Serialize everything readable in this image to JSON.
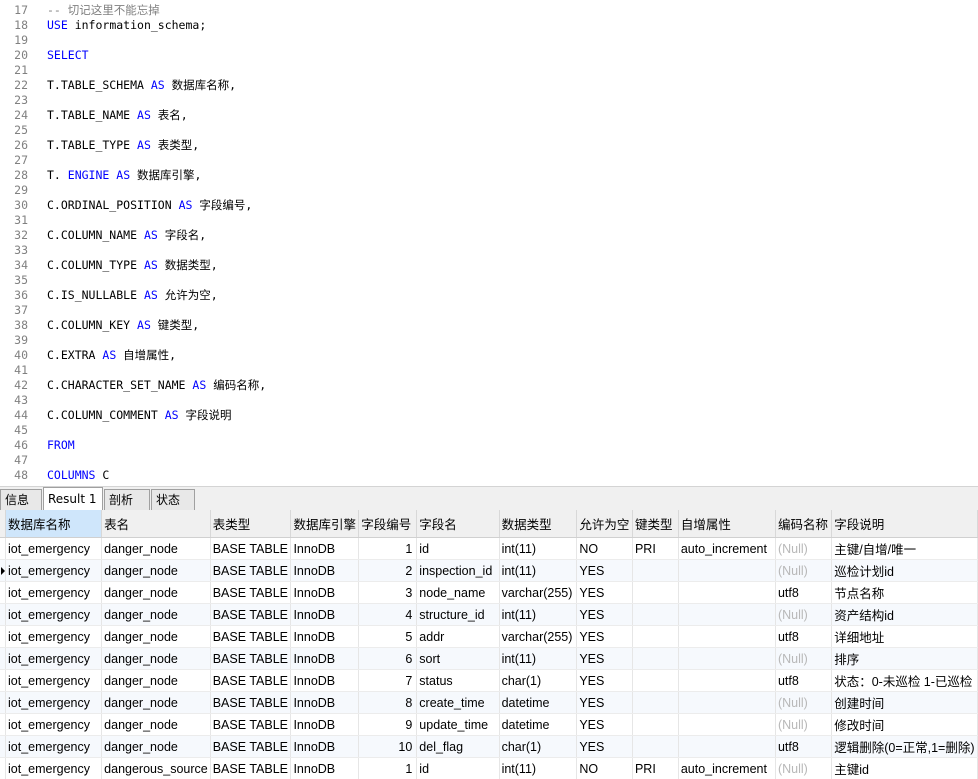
{
  "editor": {
    "lines": [
      {
        "n": "17",
        "parts": [
          {
            "t": "-- 切记这里不能忘掉",
            "c": "cm"
          }
        ]
      },
      {
        "n": "18",
        "parts": [
          {
            "t": "USE",
            "c": "kw"
          },
          {
            "t": " information_schema;",
            "c": ""
          }
        ]
      },
      {
        "n": "19",
        "parts": []
      },
      {
        "n": "20",
        "parts": [
          {
            "t": "SELECT",
            "c": "kw"
          }
        ]
      },
      {
        "n": "21",
        "parts": []
      },
      {
        "n": "22",
        "parts": [
          {
            "t": "T.TABLE_SCHEMA ",
            "c": ""
          },
          {
            "t": "AS",
            "c": "kw"
          },
          {
            "t": " 数据库名称,",
            "c": ""
          }
        ]
      },
      {
        "n": "23",
        "parts": []
      },
      {
        "n": "24",
        "parts": [
          {
            "t": "T.TABLE_NAME ",
            "c": ""
          },
          {
            "t": "AS",
            "c": "kw"
          },
          {
            "t": " 表名,",
            "c": ""
          }
        ]
      },
      {
        "n": "25",
        "parts": []
      },
      {
        "n": "26",
        "parts": [
          {
            "t": "T.TABLE_TYPE ",
            "c": ""
          },
          {
            "t": "AS",
            "c": "kw"
          },
          {
            "t": " 表类型,",
            "c": ""
          }
        ]
      },
      {
        "n": "27",
        "parts": []
      },
      {
        "n": "28",
        "parts": [
          {
            "t": "T. ",
            "c": ""
          },
          {
            "t": "ENGINE",
            "c": "kw"
          },
          {
            "t": " ",
            "c": ""
          },
          {
            "t": "AS",
            "c": "kw"
          },
          {
            "t": " 数据库引擎,",
            "c": ""
          }
        ]
      },
      {
        "n": "29",
        "parts": []
      },
      {
        "n": "30",
        "parts": [
          {
            "t": "C.ORDINAL_POSITION ",
            "c": ""
          },
          {
            "t": "AS",
            "c": "kw"
          },
          {
            "t": " 字段编号,",
            "c": ""
          }
        ]
      },
      {
        "n": "31",
        "parts": []
      },
      {
        "n": "32",
        "parts": [
          {
            "t": "C.COLUMN_NAME ",
            "c": ""
          },
          {
            "t": "AS",
            "c": "kw"
          },
          {
            "t": " 字段名,",
            "c": ""
          }
        ]
      },
      {
        "n": "33",
        "parts": []
      },
      {
        "n": "34",
        "parts": [
          {
            "t": "C.COLUMN_TYPE ",
            "c": ""
          },
          {
            "t": "AS",
            "c": "kw"
          },
          {
            "t": " 数据类型,",
            "c": ""
          }
        ]
      },
      {
        "n": "35",
        "parts": []
      },
      {
        "n": "36",
        "parts": [
          {
            "t": "C.IS_NULLABLE ",
            "c": ""
          },
          {
            "t": "AS",
            "c": "kw"
          },
          {
            "t": " 允许为空,",
            "c": ""
          }
        ]
      },
      {
        "n": "37",
        "parts": []
      },
      {
        "n": "38",
        "parts": [
          {
            "t": "C.COLUMN_KEY ",
            "c": ""
          },
          {
            "t": "AS",
            "c": "kw"
          },
          {
            "t": " 键类型,",
            "c": ""
          }
        ]
      },
      {
        "n": "39",
        "parts": []
      },
      {
        "n": "40",
        "parts": [
          {
            "t": "C.EXTRA ",
            "c": ""
          },
          {
            "t": "AS",
            "c": "kw"
          },
          {
            "t": " 自增属性,",
            "c": ""
          }
        ]
      },
      {
        "n": "41",
        "parts": []
      },
      {
        "n": "42",
        "parts": [
          {
            "t": "C.CHARACTER_SET_NAME ",
            "c": ""
          },
          {
            "t": "AS",
            "c": "kw"
          },
          {
            "t": " 编码名称,",
            "c": ""
          }
        ]
      },
      {
        "n": "43",
        "parts": []
      },
      {
        "n": "44",
        "parts": [
          {
            "t": "C.COLUMN_COMMENT ",
            "c": ""
          },
          {
            "t": "AS",
            "c": "kw"
          },
          {
            "t": " 字段说明",
            "c": ""
          }
        ]
      },
      {
        "n": "45",
        "parts": []
      },
      {
        "n": "46",
        "parts": [
          {
            "t": "FROM",
            "c": "kw"
          }
        ]
      },
      {
        "n": "47",
        "parts": []
      },
      {
        "n": "48",
        "parts": [
          {
            "t": "COLUMNS",
            "c": "kw"
          },
          {
            "t": " C",
            "c": ""
          }
        ]
      }
    ]
  },
  "tabs": [
    {
      "label": "信息",
      "active": false
    },
    {
      "label": "Result 1",
      "active": true
    },
    {
      "label": "剖析",
      "active": false
    },
    {
      "label": "状态",
      "active": false
    }
  ],
  "grid": {
    "columns": [
      "数据库名称",
      "表名",
      "表类型",
      "数据库引擎",
      "字段编号",
      "字段名",
      "数据类型",
      "允许为空",
      "键类型",
      "自增属性",
      "编码名称",
      "字段说明"
    ],
    "rows": [
      [
        "iot_emergency",
        "danger_node",
        "BASE TABLE",
        "InnoDB",
        "1",
        "id",
        "int(11)",
        "NO",
        "PRI",
        "auto_increment",
        "(Null)",
        "主键/自增/唯一"
      ],
      [
        "iot_emergency",
        "danger_node",
        "BASE TABLE",
        "InnoDB",
        "2",
        "inspection_id",
        "int(11)",
        "YES",
        "",
        "",
        "(Null)",
        "巡检计划id"
      ],
      [
        "iot_emergency",
        "danger_node",
        "BASE TABLE",
        "InnoDB",
        "3",
        "node_name",
        "varchar(255)",
        "YES",
        "",
        "",
        "utf8",
        "节点名称"
      ],
      [
        "iot_emergency",
        "danger_node",
        "BASE TABLE",
        "InnoDB",
        "4",
        "structure_id",
        "int(11)",
        "YES",
        "",
        "",
        "(Null)",
        "资产结构id"
      ],
      [
        "iot_emergency",
        "danger_node",
        "BASE TABLE",
        "InnoDB",
        "5",
        "addr",
        "varchar(255)",
        "YES",
        "",
        "",
        "utf8",
        "详细地址"
      ],
      [
        "iot_emergency",
        "danger_node",
        "BASE TABLE",
        "InnoDB",
        "6",
        "sort",
        "int(11)",
        "YES",
        "",
        "",
        "(Null)",
        "排序"
      ],
      [
        "iot_emergency",
        "danger_node",
        "BASE TABLE",
        "InnoDB",
        "7",
        "status",
        "char(1)",
        "YES",
        "",
        "",
        "utf8",
        "状态：0-未巡检 1-已巡检"
      ],
      [
        "iot_emergency",
        "danger_node",
        "BASE TABLE",
        "InnoDB",
        "8",
        "create_time",
        "datetime",
        "YES",
        "",
        "",
        "(Null)",
        "创建时间"
      ],
      [
        "iot_emergency",
        "danger_node",
        "BASE TABLE",
        "InnoDB",
        "9",
        "update_time",
        "datetime",
        "YES",
        "",
        "",
        "(Null)",
        "修改时间"
      ],
      [
        "iot_emergency",
        "danger_node",
        "BASE TABLE",
        "InnoDB",
        "10",
        "del_flag",
        "char(1)",
        "YES",
        "",
        "",
        "utf8",
        "逻辑删除(0=正常,1=删除)"
      ],
      [
        "iot_emergency",
        "dangerous_source",
        "BASE TABLE",
        "InnoDB",
        "1",
        "id",
        "int(11)",
        "NO",
        "PRI",
        "auto_increment",
        "(Null)",
        "主键id"
      ]
    ],
    "current_row": 1
  }
}
